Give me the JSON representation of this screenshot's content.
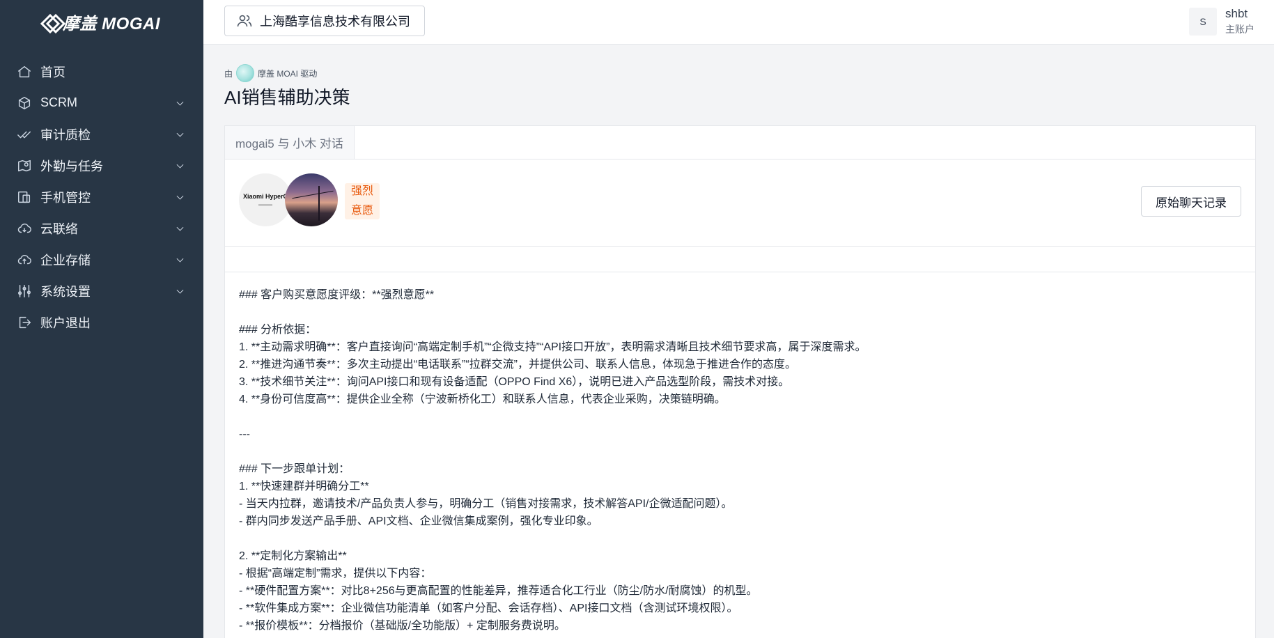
{
  "brand": {
    "name": "摩盖 MOGAI"
  },
  "sidebar": {
    "items": [
      {
        "label": "首页",
        "icon": "home-icon",
        "expandable": false
      },
      {
        "label": "SCRM",
        "icon": "cube-icon",
        "expandable": true
      },
      {
        "label": "审计质检",
        "icon": "check-double-icon",
        "expandable": true
      },
      {
        "label": "外勤与任务",
        "icon": "map-pin-icon",
        "expandable": true
      },
      {
        "label": "手机管控",
        "icon": "phone-icon",
        "expandable": true
      },
      {
        "label": "云联络",
        "icon": "cloud-icon",
        "expandable": true
      },
      {
        "label": "企业存储",
        "icon": "cloud-upload-icon",
        "expandable": true
      },
      {
        "label": "系统设置",
        "icon": "sliders-icon",
        "expandable": true
      },
      {
        "label": "账户退出",
        "icon": "logout-icon",
        "expandable": false
      }
    ]
  },
  "header": {
    "company": "上海酷享信息技术有限公司",
    "user": {
      "initial": "S",
      "name": "shbt",
      "role": "主账户"
    }
  },
  "main": {
    "powered_prefix": "由",
    "powered_text": "摩盖 MOAI 驱动",
    "title": "AI销售辅助决策",
    "tab": "mogai5 与 小木 对话",
    "brand_avatar_text": "Xiaomi HyperC",
    "intent_badge": "强烈意愿",
    "history_button": "原始聊天记录",
    "analysis_lines": [
      "### 客户购买意愿度评级：**强烈意愿**",
      "",
      "### 分析依据：",
      "1. **主动需求明确**：客户直接询问“高端定制手机”“企微支持”“API接口开放”，表明需求清晰且技术细节要求高，属于深度需求。",
      "2. **推进沟通节奏**：多次主动提出“电话联系”“拉群交流”，并提供公司、联系人信息，体现急于推进合作的态度。",
      "3. **技术细节关注**：询问API接口和现有设备适配（OPPO Find X6），说明已进入产品选型阶段，需技术对接。",
      "4. **身份可信度高**：提供企业全称（宁波新桥化工）和联系人信息，代表企业采购，决策链明确。",
      "",
      "---",
      "",
      "### 下一步跟单计划：",
      "1. **快速建群并明确分工**",
      "- 当天内拉群，邀请技术/产品负责人参与，明确分工（销售对接需求，技术解答API/企微适配问题）。",
      "- 群内同步发送产品手册、API文档、企业微信集成案例，强化专业印象。",
      "",
      "2. **定制化方案输出**",
      "- 根据“高端定制”需求，提供以下内容：",
      "- **硬件配置方案**：对比8+256与更高配置的性能差异，推荐适合化工行业（防尘/防水/耐腐蚀）的机型。",
      "- **软件集成方案**：企业微信功能清单（如客户分配、会话存档）、API接口文档（含测试环境权限）。",
      "- **报价模板**：分档报价（基础版/全功能版）+ 定制服务费说明。"
    ]
  }
}
